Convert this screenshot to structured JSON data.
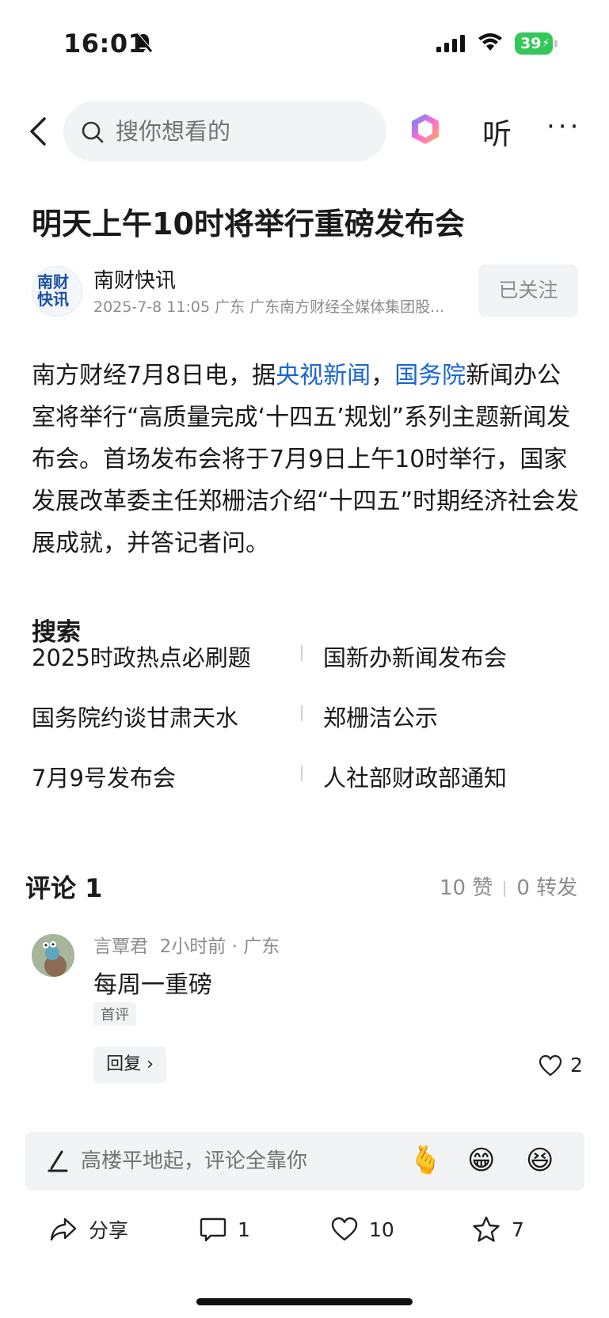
{
  "status_bar": {
    "time": "16:01",
    "battery": "39"
  },
  "nav": {
    "search_placeholder": "搜你想看的",
    "listen_label": "听",
    "more_label": "···",
    "icons": [
      "back-arrow-icon",
      "search-icon",
      "ai-assistant-icon",
      "more-icon"
    ]
  },
  "article": {
    "title": "明天上午10时将举行重磅发布会",
    "author": "南财快讯",
    "avatar_text": [
      "南财",
      "快讯"
    ],
    "meta": "2025-7-8  11:05  广东  广东南方财经全媒体集团股...",
    "follow_label": "已关注",
    "body": {
      "p1_before": "南方财经7月8日电，据",
      "link1": "央视新闻",
      "p1_mid": "，",
      "link2": "国务院",
      "p1_after": "新闻办公室将举行“高质量完成‘十四五’规划”系列主题新闻发布会。首场发布会将于7月9日上午10时举行，国家发展改革委主任郑栅洁介绍“十四五”时期经济社会发展成就，并答记者问。"
    }
  },
  "search_section": {
    "title": "搜索",
    "items": [
      "2025时政热点必刷题",
      "国新办新闻发布会",
      "国务院约谈甘肃天水",
      "郑栅洁公示",
      "7月9号发布会",
      "人社部财政部通知"
    ]
  },
  "comments": {
    "title": "评论 1",
    "likes": "10 赞",
    "shares": "0 转发",
    "items": [
      {
        "user": "言覃君",
        "time_location": "2小时前 · 广东",
        "text": "每周一重磅",
        "tag": "首评",
        "reply_label": "回复",
        "like_count": "2"
      }
    ]
  },
  "compose": {
    "placeholder": "高楼平地起，评论全靠你",
    "emojis": [
      "🫰",
      "😁",
      "😆"
    ]
  },
  "bottom_bar": {
    "share_label": "分享",
    "comment_count": "1",
    "like_count": "10",
    "favorite_count": "7"
  },
  "colors": {
    "link": "#1a66d2",
    "muted": "#8c8c8c",
    "battery": "#34c759"
  }
}
